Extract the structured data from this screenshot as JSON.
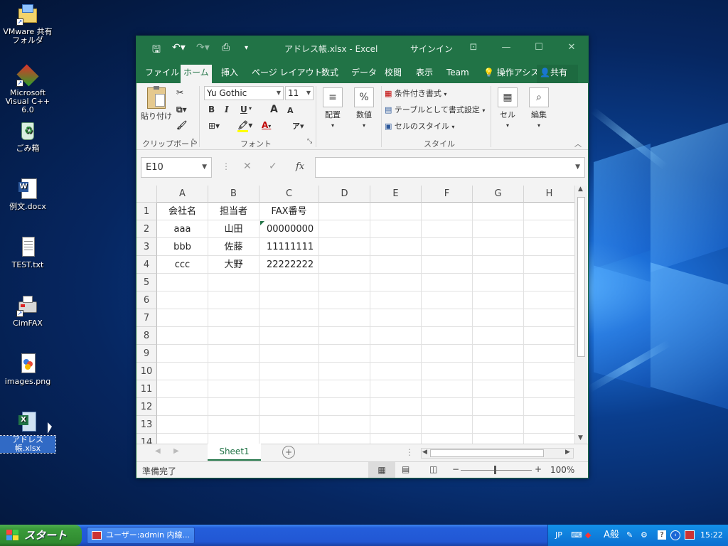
{
  "desktop": {
    "icons": [
      {
        "label": "VMware 共有フォルダ"
      },
      {
        "label": "Microsoft Visual C++ 6.0"
      },
      {
        "label": "ごみ箱"
      },
      {
        "label": "例文.docx"
      },
      {
        "label": "TEST.txt"
      },
      {
        "label": "CimFAX"
      },
      {
        "label": "images.png"
      },
      {
        "label": "アドレス帳.xlsx"
      }
    ]
  },
  "excel": {
    "title": "アドレス帳.xlsx  -  Excel",
    "signin": "サインイン",
    "tabs": [
      "ファイル",
      "ホーム",
      "挿入",
      "ページ レイアウト",
      "数式",
      "データ",
      "校閲",
      "表示",
      "Team"
    ],
    "active_tab": "ホーム",
    "tellme": "操作アシス",
    "share": "共有",
    "ribbon": {
      "paste": "貼り付け",
      "clipboard_group": "クリップボード",
      "font_name": "Yu Gothic",
      "font_size": "11",
      "font_group": "フォント",
      "bold": "B",
      "italic": "I",
      "underline": "U",
      "grow_font": "A",
      "shrink_font": "A",
      "alignment": "配置",
      "number": "数値",
      "percent": "%",
      "cond_format": "条件付き書式",
      "format_table": "テーブルとして書式設定",
      "cell_styles": "セルのスタイル",
      "styles_group": "スタイル",
      "cells": "セル",
      "editing": "編集"
    },
    "name_box": "E10",
    "fx_label": "fx",
    "columns": [
      "A",
      "B",
      "C",
      "D",
      "E",
      "F",
      "G",
      "H"
    ],
    "rows": [
      "1",
      "2",
      "3",
      "4",
      "5",
      "6",
      "7",
      "8",
      "9",
      "10",
      "11",
      "12",
      "13",
      "14"
    ],
    "cells": [
      [
        "会社名",
        "担当者",
        "FAX番号"
      ],
      [
        "aaa",
        "山田",
        "00000000"
      ],
      [
        "bbb",
        "佐藤",
        "11111111"
      ],
      [
        "ccc",
        "大野",
        "22222222"
      ]
    ],
    "sheet_tab": "Sheet1",
    "status": "準備完了",
    "zoom": "100%",
    "colors": {
      "accent": "#217346"
    }
  },
  "taskbar": {
    "start_label": "スタート",
    "task_item": "ユーザー:admin  内線...",
    "tray_lang": "JP",
    "tray_ime": "A般",
    "clock": "15:22"
  }
}
